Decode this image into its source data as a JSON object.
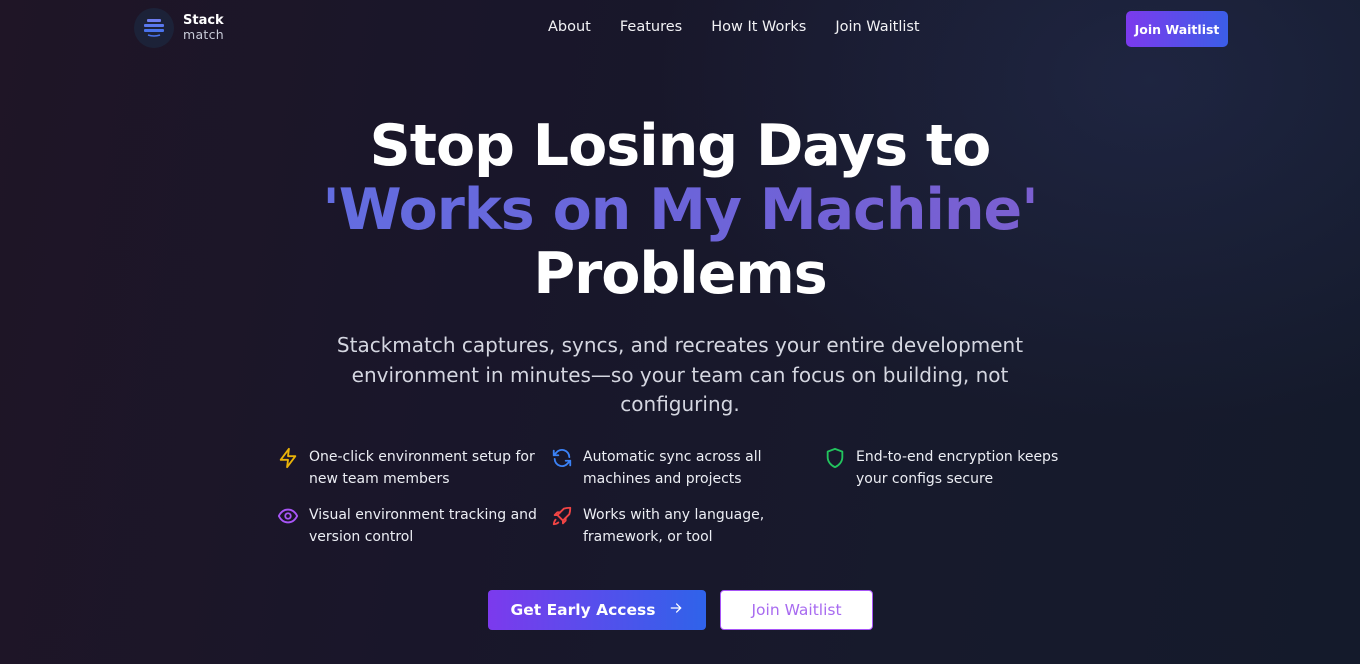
{
  "brand": {
    "name_line1": "Stack",
    "name_line2": "match"
  },
  "nav": {
    "links": [
      "About",
      "Features",
      "How It Works",
      "Join Waitlist"
    ],
    "cta": "Join Waitlist"
  },
  "hero": {
    "title_line1": "Stop Losing Days to",
    "title_line2": "'Works on My Machine'",
    "title_line3": "Problems",
    "subtitle": "Stackmatch captures, syncs, and recreates your entire development environment in minutes—so your team can focus on building, not configuring."
  },
  "features": [
    {
      "icon": "lightning-icon",
      "text": "One-click environment setup for new team members",
      "color": "#eab308"
    },
    {
      "icon": "sync-icon",
      "text": "Automatic sync across all machines and projects",
      "color": "#3b82f6"
    },
    {
      "icon": "shield-icon",
      "text": "End-to-end encryption keeps your configs secure",
      "color": "#22c55e"
    },
    {
      "icon": "eye-icon",
      "text": "Visual environment tracking and version control",
      "color": "#a855f7"
    },
    {
      "icon": "rocket-icon",
      "text": "Works with any language, framework, or tool",
      "color": "#ef4444"
    }
  ],
  "cta": {
    "primary": "Get Early Access",
    "primary_icon": "arrow-right-icon",
    "secondary": "Join Waitlist"
  },
  "colors": {
    "accent_purple": "#7c3aed",
    "accent_blue": "#3b5ee8",
    "background": "#1a1729"
  }
}
